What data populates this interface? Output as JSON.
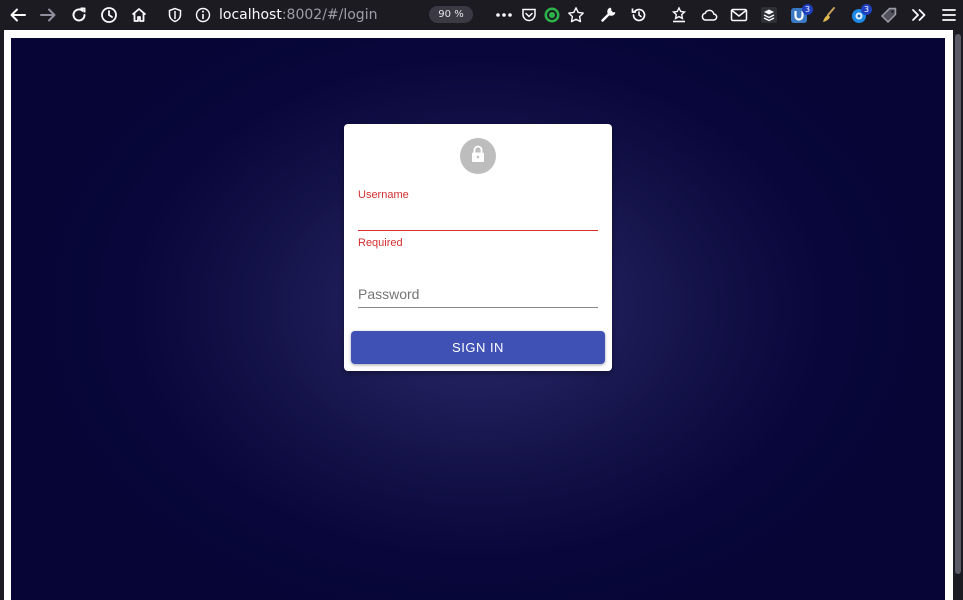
{
  "browser": {
    "url_host": "localhost",
    "url_path": ":8002/#/login",
    "zoom": "90 %",
    "extension_badges": [
      "3",
      "3"
    ]
  },
  "login": {
    "username_label": "Username",
    "username_value": "",
    "username_helper": "Required",
    "password_placeholder": "Password",
    "password_value": "",
    "submit_label": "SIGN IN"
  },
  "colors": {
    "background": "#08063b",
    "primary": "#3f51b5",
    "error": "#d32f2f",
    "avatar": "#bdbdbd"
  },
  "icons": {
    "avatar": "lock-icon"
  }
}
